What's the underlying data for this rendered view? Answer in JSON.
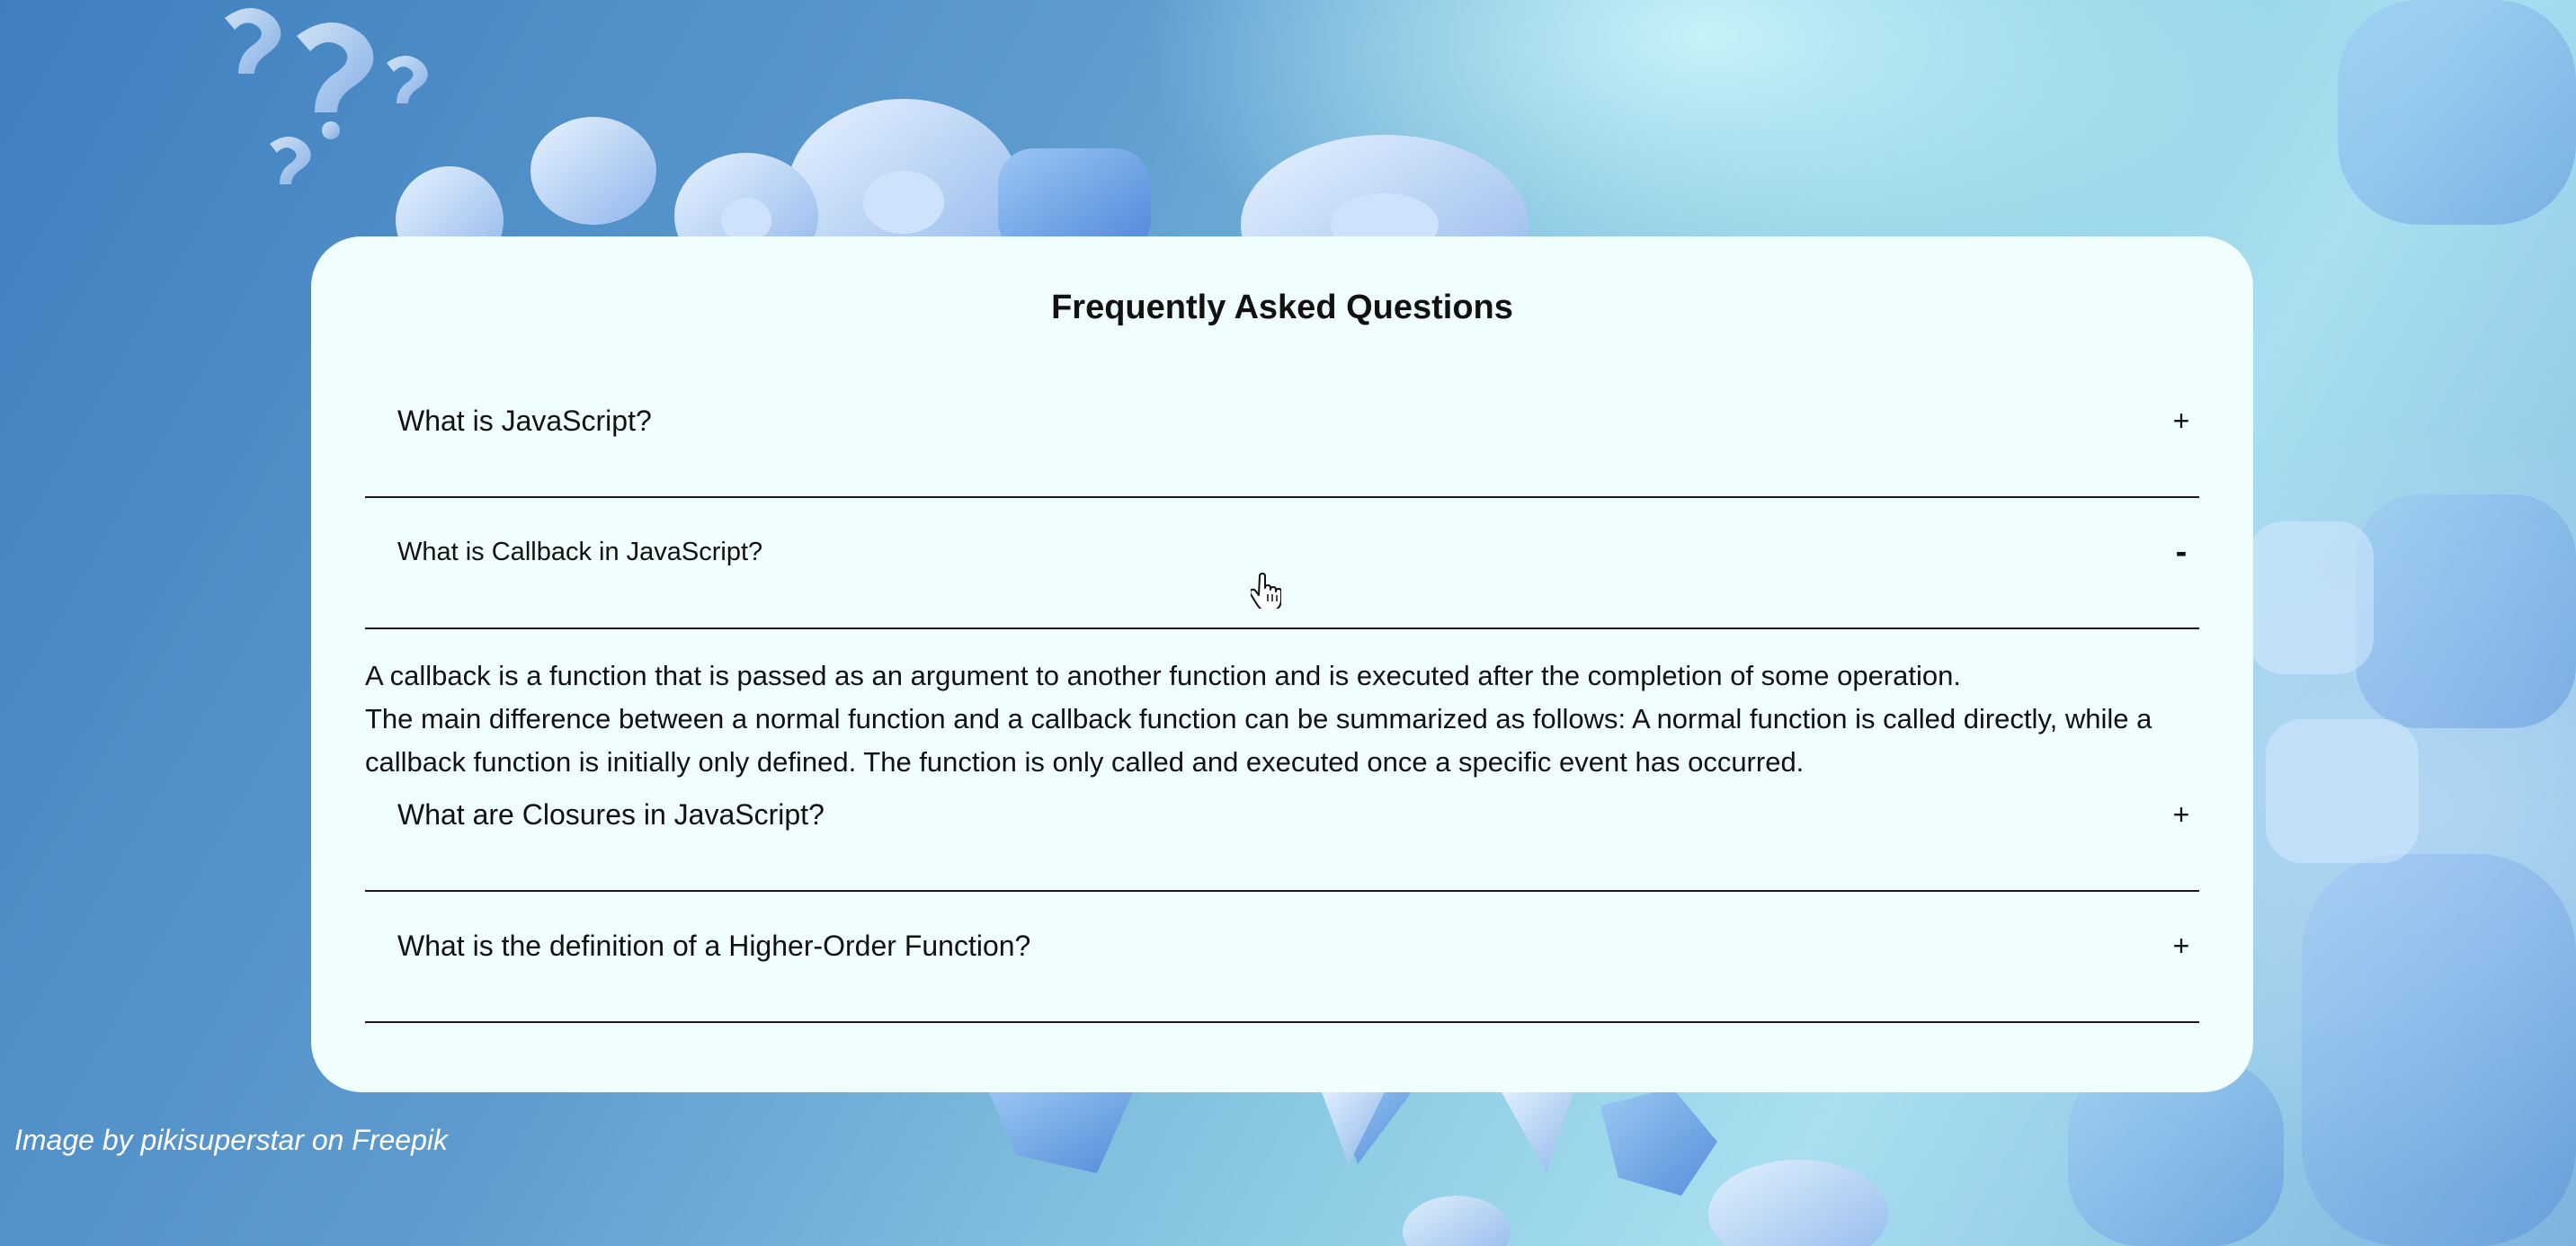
{
  "page": {
    "title": "Frequently Asked Questions",
    "credit": "Image by pikisuperstar on Freepik"
  },
  "faq": [
    {
      "question": "What is JavaScript?",
      "toggle": "+",
      "expanded": false
    },
    {
      "question": "What is Callback in JavaScript?",
      "toggle": "-",
      "expanded": true,
      "answer_lines": [
        "A callback is a function that is passed as an argument to another function and is executed after the completion of some operation.",
        "The main difference between a normal function and a callback function can be summarized as follows: A normal function is called directly, while a callback function is initially only defined. The function is only called and executed once a specific event has occurred."
      ]
    },
    {
      "question": "What are Closures in JavaScript?",
      "toggle": "+",
      "expanded": false
    },
    {
      "question": "What is the definition of a Higher-Order Function?",
      "toggle": "+",
      "expanded": false
    }
  ],
  "colors": {
    "card_background": "#f0fffe",
    "divider": "#1a1a1a",
    "text": "#111111",
    "background_blue": "#5e9ccf",
    "background_cyan": "#a9dff0"
  },
  "icons": {
    "cursor": "hand-pointer-icon",
    "background_decoration": "question-mark-icons"
  }
}
